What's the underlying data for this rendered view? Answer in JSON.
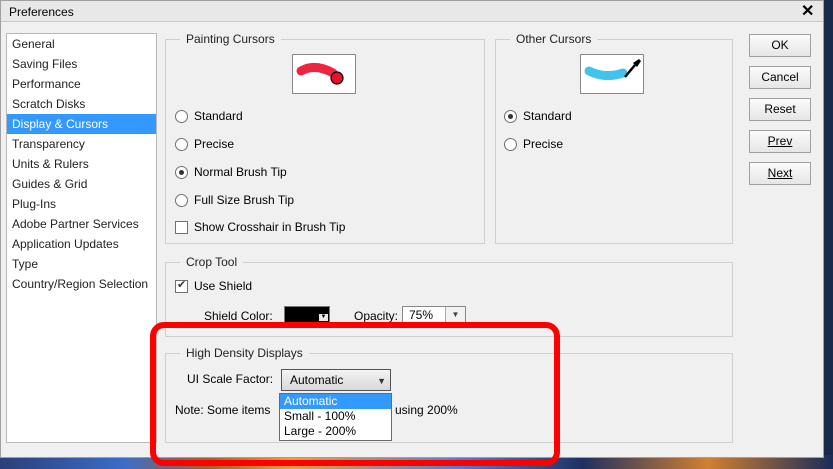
{
  "window": {
    "title": "Preferences",
    "close_glyph": "✕"
  },
  "sidebar": {
    "items": [
      {
        "label": "General"
      },
      {
        "label": "Saving Files"
      },
      {
        "label": "Performance"
      },
      {
        "label": "Scratch Disks"
      },
      {
        "label": "Display & Cursors",
        "selected": true
      },
      {
        "label": "Transparency"
      },
      {
        "label": "Units & Rulers"
      },
      {
        "label": "Guides & Grid"
      },
      {
        "label": "Plug-Ins"
      },
      {
        "label": "Adobe Partner Services"
      },
      {
        "label": "Application Updates"
      },
      {
        "label": "Type"
      },
      {
        "label": "Country/Region Selection"
      }
    ]
  },
  "painting_cursors": {
    "legend": "Painting Cursors",
    "options": [
      "Standard",
      "Precise",
      "Normal Brush Tip",
      "Full Size Brush Tip"
    ],
    "selected": "Normal Brush Tip",
    "crosshair_label": "Show Crosshair in Brush Tip",
    "crosshair_checked": false,
    "preview_color": "#e8102a"
  },
  "other_cursors": {
    "legend": "Other Cursors",
    "options": [
      "Standard",
      "Precise"
    ],
    "selected": "Standard",
    "preview_color": "#20b8e8"
  },
  "crop_tool": {
    "legend": "Crop Tool",
    "use_shield_label": "Use Shield",
    "use_shield_checked": true,
    "shield_color_label": "Shield Color:",
    "shield_color": "#000000",
    "opacity_label": "Opacity:",
    "opacity_value": "75%"
  },
  "high_density": {
    "legend": "High Density Displays",
    "scale_label": "UI Scale Factor:",
    "scale_value": "Automatic",
    "options": [
      "Automatic",
      "Small - 100%",
      "Large - 200%"
    ],
    "note_start": "Note: Some items",
    "note_end": "using 200%"
  },
  "buttons": {
    "ok": "OK",
    "cancel": "Cancel",
    "reset": "Reset",
    "prev": "Prev",
    "next": "Next"
  },
  "colors": {
    "selection": "#3399ff",
    "annotation_red": "#ff0000"
  }
}
